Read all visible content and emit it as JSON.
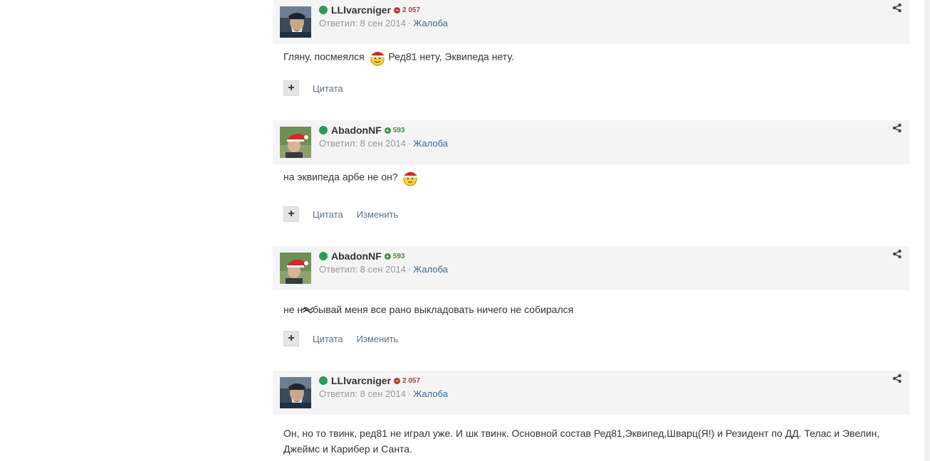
{
  "posts": [
    {
      "author": "LLlvarcniger",
      "rep": "2 057",
      "rep_type": "negative",
      "meta": "Ответил: 8 сен 2014",
      "report": "Жалоба",
      "body_before": "Гляну, посмеялся",
      "body_after": "Ред81 нету, Эквипеда нету.",
      "controls": [
        "Цитата"
      ]
    },
    {
      "author": "AbadonNF",
      "rep": "593",
      "rep_type": "positive",
      "meta": "Ответил: 8 сен 2014",
      "report": "Жалоба",
      "body_before": "на эквипеда арбе не он?",
      "body_after": "",
      "controls": [
        "Цитата",
        "Изменить"
      ]
    },
    {
      "author": "AbadonNF",
      "rep": "593",
      "rep_type": "positive",
      "meta": "Ответил: 8 сен 2014",
      "report": "Жалоба",
      "body_before": "не н",
      "body_after": "бывай меня все рано выкладовать ничего не собирался",
      "controls": [
        "Цитата",
        "Изменить"
      ]
    },
    {
      "author": "LLlvarcniger",
      "rep": "2 057",
      "rep_type": "negative",
      "meta": "Ответил: 8 сен 2014",
      "report": "Жалоба",
      "body_full": "Он, но то твинк, ред81 не играл уже. И шк твинк. Основной состав Ред81,Эквипед,Шварц(Я!) и Резидент по ДД. Телас и Эвелин, Джеймс и Карибер и Санта."
    }
  ],
  "colors": {
    "online": "#2b9a60",
    "rep_negative": "#b23b3b",
    "rep_positive": "#3e8e41",
    "link": "#3d6594",
    "header_bg": "#f4f4f4"
  },
  "icons": [
    "share-icon",
    "plus-icon",
    "online-indicator",
    "santa-smiley-icon"
  ]
}
